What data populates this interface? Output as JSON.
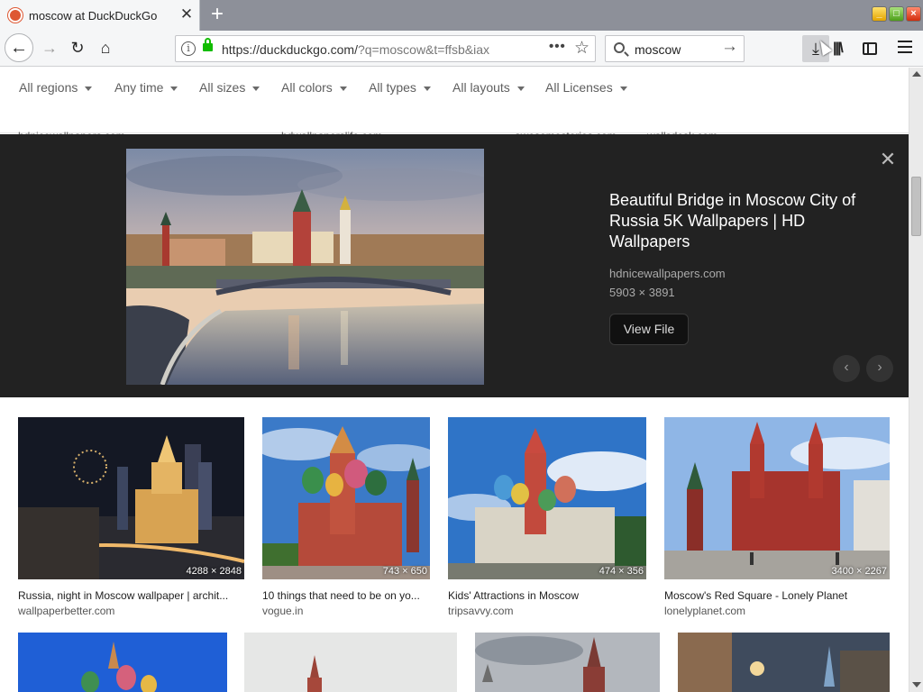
{
  "browser": {
    "tab_title": "moscow at DuckDuckGo",
    "tab_close": "✕",
    "new_tab": "+",
    "url_main": "https://duckduckgo.com/",
    "url_rest": "?q=moscow&t=ffsb&iax",
    "url_more": "•••",
    "url_star": "☆",
    "search_value": "moscow",
    "search_go": "→",
    "back": "←",
    "forward": "→",
    "reload": "↻",
    "home": "⌂",
    "download": "⤓",
    "library": "|||\\",
    "info": "i"
  },
  "filters": [
    {
      "label": "All regions"
    },
    {
      "label": "Any time"
    },
    {
      "label": "All sizes"
    },
    {
      "label": "All colors"
    },
    {
      "label": "All types"
    },
    {
      "label": "All layouts"
    },
    {
      "label": "All Licenses"
    }
  ],
  "previous_row_sources": [
    "hdnicewallpapers.com",
    "hdwallpaperslife.com",
    "awesomestories.com",
    "wallsdesk.com"
  ],
  "detail": {
    "title": "Beautiful Bridge in Moscow City of Russia 5K Wallpapers | HD Wallpapers",
    "source": "hdnicewallpapers.com",
    "dimensions": "5903 × 3891",
    "view_file": "View File",
    "close": "✕",
    "prev": "‹",
    "next": "›"
  },
  "results": [
    {
      "title": "Russia, night in Moscow wallpaper | archit...",
      "source": "wallpaperbetter.com",
      "dim": "4288 × 2848"
    },
    {
      "title": "10 things that need to be on yo...",
      "source": "vogue.in",
      "dim": "743 × 650"
    },
    {
      "title": "Kids' Attractions in Moscow",
      "source": "tripsavvy.com",
      "dim": "474 × 356"
    },
    {
      "title": "Moscow's Red Square - Lonely Planet",
      "source": "lonelyplanet.com",
      "dim": "3400 × 2267"
    }
  ],
  "colors": {
    "detail_bg": "#222222",
    "filter_text": "#5e5e5e",
    "tab_strip": "#8d9099",
    "secure_lock": "#12bc00"
  }
}
